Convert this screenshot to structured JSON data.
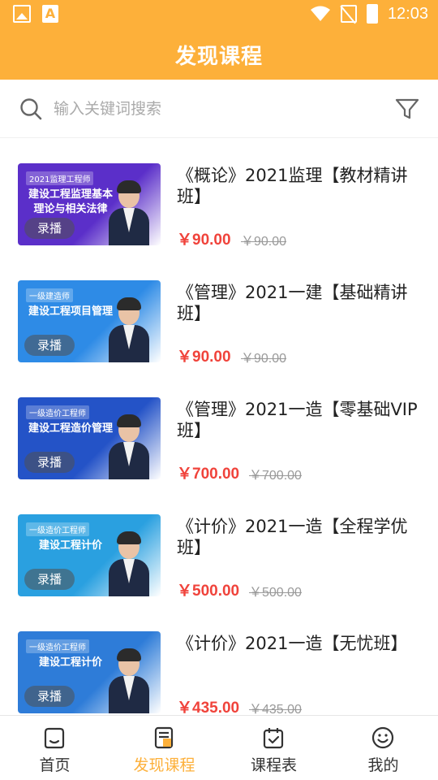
{
  "status_bar": {
    "time": "12:03",
    "app_icon_letter": "A"
  },
  "header": {
    "title": "发现课程"
  },
  "search": {
    "placeholder": "输入关键词搜索"
  },
  "courses": [
    {
      "title": "《概论》2021监理【教材精讲班】",
      "price": "￥90.00",
      "original_price": "￥90.00",
      "badge": "录播",
      "thumb": {
        "tag": "2021监理工程师",
        "headline": "建设工程监理基本理论与相关法律",
        "bg": "#5B2FC9"
      }
    },
    {
      "title": "《管理》2021一建【基础精讲班】",
      "price": "￥90.00",
      "original_price": "￥90.00",
      "badge": "录播",
      "thumb": {
        "tag": "一级建造师",
        "headline": "建设工程项目管理",
        "bg": "#2E8BE6"
      }
    },
    {
      "title": "《管理》2021一造【零基础VIP班】",
      "price": "￥700.00",
      "original_price": "￥700.00",
      "badge": "录播",
      "thumb": {
        "tag": "一级造价工程师",
        "headline": "建设工程造价管理",
        "bg": "#2453C7"
      }
    },
    {
      "title": "《计价》2021一造【全程学优班】",
      "price": "￥500.00",
      "original_price": "￥500.00",
      "badge": "录播",
      "thumb": {
        "tag": "一级造价工程师",
        "headline": "建设工程计价",
        "bg": "#2AA0E0"
      }
    },
    {
      "title": "《计价》2021一造【无忧班】",
      "price": "￥435.00",
      "original_price": "￥435.00",
      "badge": "录播",
      "thumb": {
        "tag": "一级造价工程师",
        "headline": "建设工程计价",
        "bg": "#2E7CD8"
      }
    }
  ],
  "bottom_nav": [
    {
      "label": "首页",
      "icon": "home-icon",
      "active": false
    },
    {
      "label": "发现课程",
      "icon": "course-icon",
      "active": true
    },
    {
      "label": "课程表",
      "icon": "calendar-icon",
      "active": false
    },
    {
      "label": "我的",
      "icon": "smile-icon",
      "active": false
    }
  ],
  "colors": {
    "brand": "#FDB03A",
    "price": "#F0433B",
    "muted": "#999999"
  }
}
